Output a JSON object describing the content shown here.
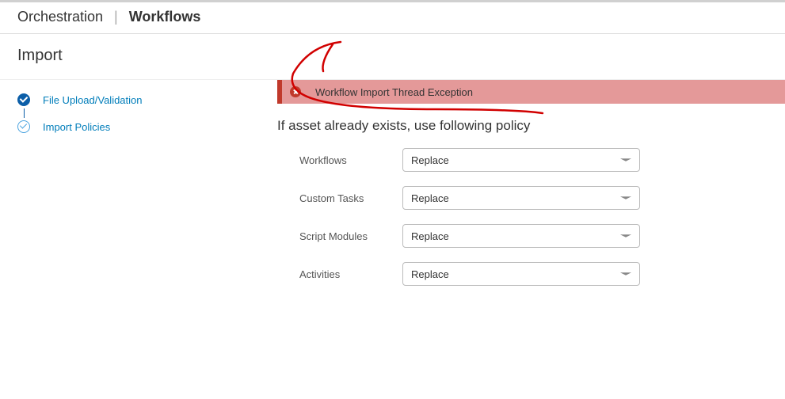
{
  "breadcrumb": {
    "parent": "Orchestration",
    "current": "Workflows"
  },
  "page_title": "Import",
  "sidebar": {
    "steps": [
      {
        "label": "File Upload/Validation",
        "state": "done"
      },
      {
        "label": "Import Policies",
        "state": "current"
      }
    ]
  },
  "error": {
    "message": "Workflow Import Thread Exception"
  },
  "section_heading": "If asset already exists, use following policy",
  "fields": [
    {
      "label": "Workflows",
      "value": "Replace"
    },
    {
      "label": "Custom Tasks",
      "value": "Replace"
    },
    {
      "label": "Script Modules",
      "value": "Replace"
    },
    {
      "label": "Activities",
      "value": "Replace"
    }
  ]
}
